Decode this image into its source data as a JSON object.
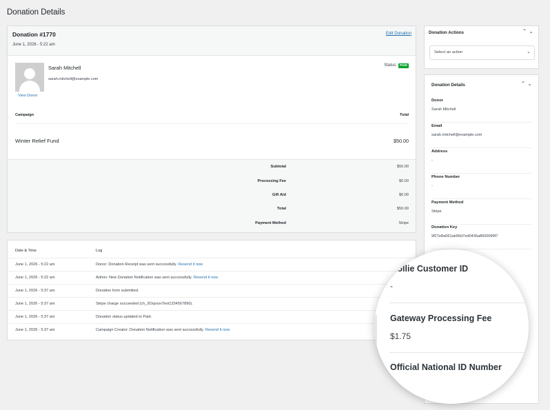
{
  "page": {
    "title": "Donation Details"
  },
  "donation": {
    "title": "Donation #1770",
    "date": "June 1, 2026 - 5:22 am",
    "edit_label": "Edit Donation",
    "donor_name": "Sarah Mitchell",
    "donor_email": "sarah.mitchell@example.com",
    "view_donor_label": "View Donor",
    "status_label": "Status:",
    "status_value": "PAID",
    "col_campaign": "Campaign",
    "col_total": "Total",
    "campaign_name": "Winter Relief Fund",
    "campaign_total": "$50.00",
    "summary": [
      {
        "label": "Subtotal",
        "value": "$50.00"
      },
      {
        "label": "Processing Fee",
        "value": "$0.00"
      },
      {
        "label": "Gift Aid",
        "value": "$0.00"
      },
      {
        "label": "Total",
        "value": "$50.00"
      },
      {
        "label": "Payment Method",
        "value": "Stripe"
      }
    ]
  },
  "log": {
    "col_date": "Date & Time",
    "col_log": "Log",
    "rows": [
      {
        "date": "June 1, 2026 - 5:22 am",
        "text": "Donor: Donation Receipt was sent successfully.",
        "link": "Resend it now"
      },
      {
        "date": "June 1, 2026 - 5:22 am",
        "text": "Admin: New Donation Notification was sent successfully.",
        "link": "Resend it now"
      },
      {
        "date": "June 1, 2026 - 5:37 am",
        "text": "Donation form submitted.",
        "link": ""
      },
      {
        "date": "June 1, 2026 - 5:37 am",
        "text": "Stripe charge succeeded (ch_3OqxxxxTest1234567890).",
        "link": ""
      },
      {
        "date": "June 1, 2026 - 5:37 am",
        "text": "Donation status updated to Paid.",
        "link": ""
      },
      {
        "date": "June 1, 2026 - 5:37 am",
        "text": "Campaign Creator: Donation Notification was sent successfully.",
        "link": "Resend it now"
      }
    ]
  },
  "sidebar": {
    "actions_title": "Donation Actions",
    "actions_select": "Select an action",
    "details_title": "Donation Details",
    "fields": [
      {
        "label": "Donor",
        "value": "Sarah Mitchell"
      },
      {
        "label": "Email",
        "value": "sarah.mitchell@example.com"
      },
      {
        "label": "Address",
        "value": "-"
      },
      {
        "label": "Phone Number",
        "value": "-"
      },
      {
        "label": "Payment Method",
        "value": "Stripe"
      },
      {
        "label": "Donation Key",
        "value": "9f27e8a061ab96d7ed0436a8600099f7"
      }
    ]
  },
  "magnifier": {
    "fields": [
      {
        "label": "Mollie Customer ID",
        "value": "-"
      },
      {
        "label": "Gateway Processing Fee",
        "value": "$1.75"
      },
      {
        "label": "Official National ID Number",
        "value": ""
      }
    ]
  },
  "colors": {
    "accent": "#2271b1",
    "paid": "#00a32a",
    "background": "#f0f0f1"
  },
  "icons": [
    "chevron-up-icon",
    "chevron-down-icon",
    "avatar-placeholder-icon"
  ]
}
